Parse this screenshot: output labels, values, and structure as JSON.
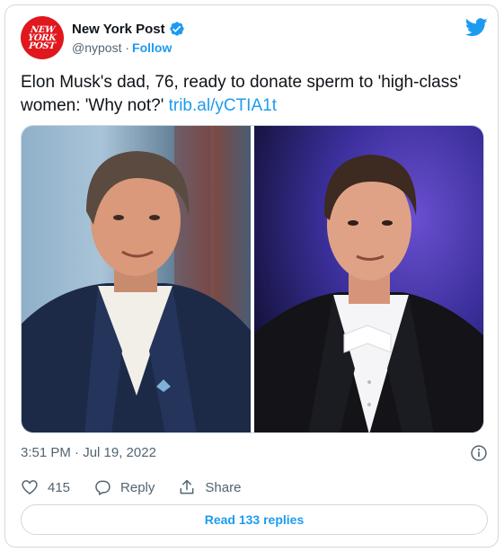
{
  "author": {
    "display_name": "New York Post",
    "handle": "@nypost",
    "follow_label": "Follow",
    "avatar_text": [
      "NEW",
      "YORK",
      "POST"
    ],
    "avatar_color": "#e0171c",
    "verified": true
  },
  "tweet": {
    "text": "Elon Musk's dad, 76, ready to donate sperm to 'high-class' women: 'Why not?' ",
    "link": "trib.al/yCTIA1t",
    "timestamp": "3:51 PM · Jul 19, 2022"
  },
  "media": {
    "images": [
      {
        "name": "photo-left",
        "subject": "older man in navy blazer and white shirt"
      },
      {
        "name": "photo-right",
        "subject": "man in white tie formal wear"
      }
    ]
  },
  "actions": {
    "like_count": "415",
    "reply_label": "Reply",
    "share_label": "Share"
  },
  "read_replies_label": "Read 133 replies",
  "colors": {
    "accent": "#1d9bf0",
    "text": "#0f1419",
    "secondary": "#536471",
    "border": "#cfd9de"
  },
  "icons": [
    "verified-badge-icon",
    "twitter-bird-icon",
    "info-icon",
    "heart-icon",
    "reply-icon",
    "share-icon"
  ]
}
